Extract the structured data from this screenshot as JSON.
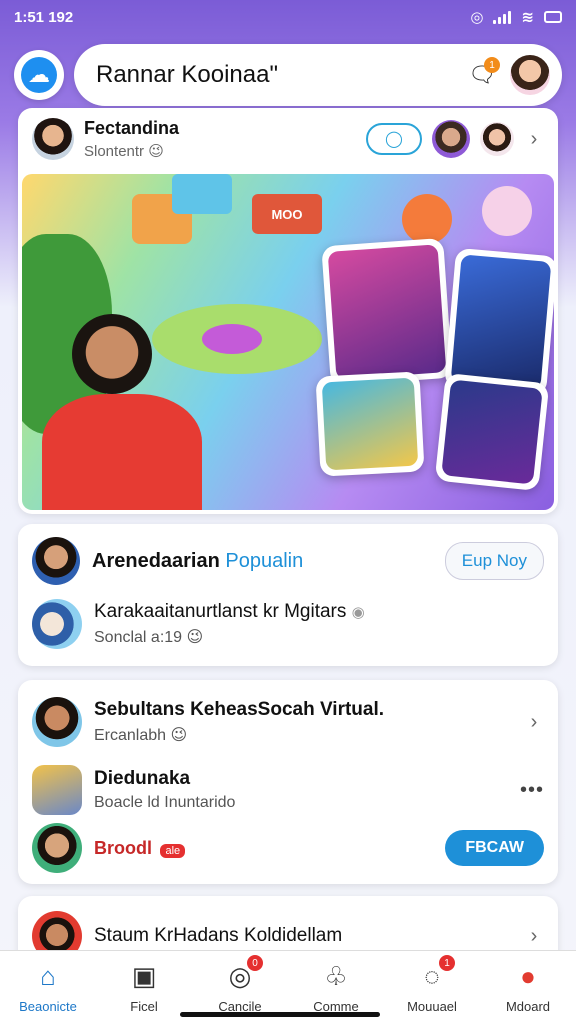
{
  "status_bar": {
    "time": "1:51 192"
  },
  "header": {
    "title": "Rannar Kooinaa\"",
    "message_badge": "1"
  },
  "hero": {
    "name": "Fectandina",
    "subtitle": "Slontentr 😉",
    "sign_text": "MOO"
  },
  "card_popular": {
    "title": "Arenedaarian",
    "title_accent": "Popualin",
    "button": "Eup Noy",
    "item_title": "Karakaaitanurtlanst kr Mgitars",
    "item_sub": "Sonclal a:19 😉"
  },
  "card_social": {
    "title": "Sebultans KeheasSocah Virtual.",
    "subtitle": "Ercanlabh 😉",
    "item_title": "Diedunaka",
    "item_sub": "Boacle ld Inuntarido",
    "tag_text": "Broodl",
    "tag_badge": "ale",
    "button": "FBCAW"
  },
  "card_bottom": {
    "title": "Staum KrHadans Koldidellam"
  },
  "nav": [
    {
      "label": "Beaonicte",
      "icon": "home-icon"
    },
    {
      "label": "Ficel",
      "icon": "feed-icon"
    },
    {
      "label": "Cancile",
      "icon": "camera-icon",
      "badge": "0"
    },
    {
      "label": "Comme",
      "icon": "community-icon"
    },
    {
      "label": "Mouuael",
      "icon": "chat-icon",
      "badge": "1"
    },
    {
      "label": "Mdoard",
      "icon": "profile-icon"
    }
  ],
  "colors": {
    "accent": "#1e90d8",
    "brand_purple": "#7b5cd6",
    "badge_red": "#e53030"
  }
}
